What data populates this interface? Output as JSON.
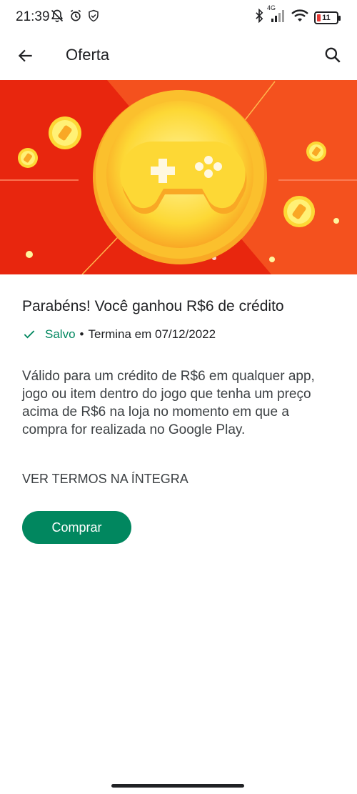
{
  "status_bar": {
    "time": "21:39",
    "network": "4G",
    "battery": "11",
    "icons_left": [
      "mute-notifications-icon",
      "alarm-icon",
      "shield-icon"
    ],
    "icons_right": [
      "bluetooth-icon",
      "signal-icon",
      "wifi-icon",
      "battery-icon"
    ]
  },
  "app_bar": {
    "title": "Oferta",
    "back_icon": "arrow-back-icon",
    "search_icon": "search-icon"
  },
  "banner": {
    "image": "gamepad-coin-illustration",
    "colors": {
      "left": "#e8260e",
      "right": "#f4511e",
      "coin": "#fbc02d"
    }
  },
  "offer": {
    "title": "Parabéns! Você ganhou R$6 de crédito",
    "saved_label": "Salvo",
    "separator": "•",
    "ends_label": "Termina em 07/12/2022",
    "description": "Válido para um crédito de R$6 em qualquer app, jogo ou item dentro do jogo que tenha um preço acima de R$6 na loja no momento em que a compra for realizada no Google Play.",
    "terms_link": "VER TERMOS NA ÍNTEGRA",
    "buy_button": "Comprar"
  },
  "colors": {
    "accent": "#01875f",
    "text": "#202124",
    "secondary_text": "#3c4043"
  }
}
